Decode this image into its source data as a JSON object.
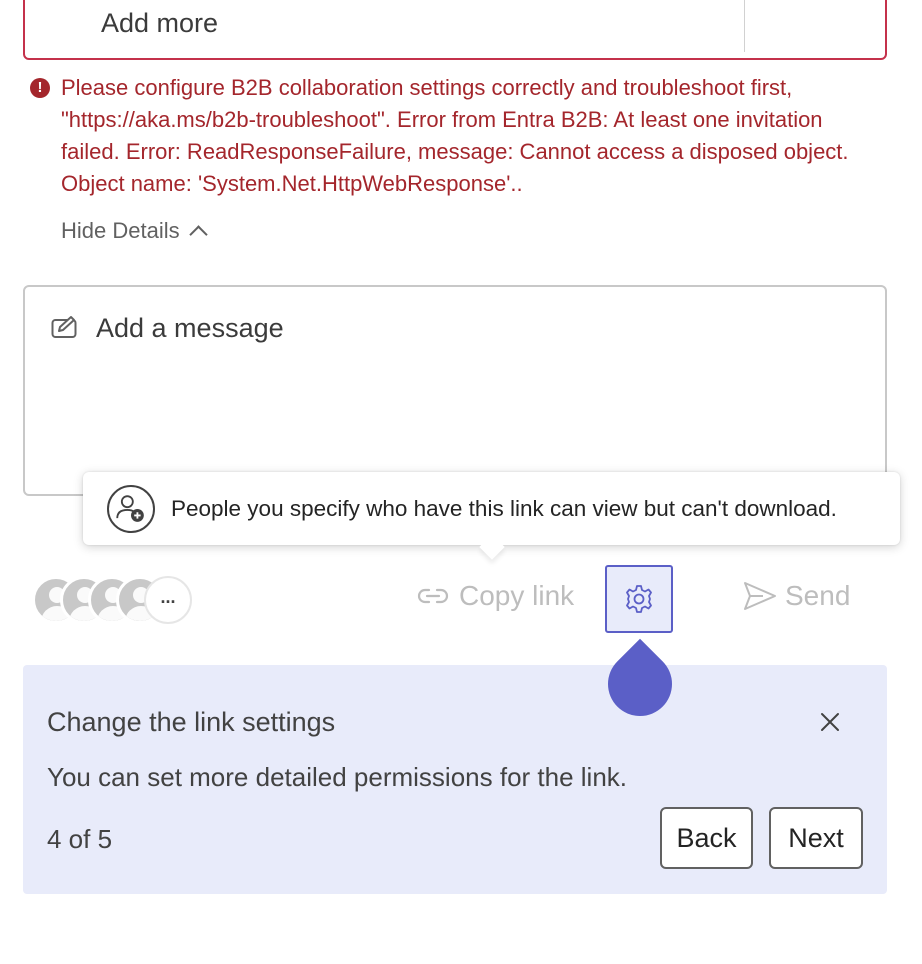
{
  "invite": {
    "add_more_label": "Add more"
  },
  "error": {
    "icon": "error-circle-icon",
    "message": "Please configure B2B collaboration settings correctly and troubleshoot first, \"https://aka.ms/b2b-troubleshoot\". Error from Entra B2B: At least one invitation failed. Error: ReadResponseFailure, message: Cannot access a disposed object. Object name: 'System.Net.HttpWebResponse'..",
    "hide_details_label": "Hide Details"
  },
  "message": {
    "placeholder": "Add a message"
  },
  "tooltip": {
    "text": "People you specify who have this link can view but can't download."
  },
  "actions": {
    "more_label": "...",
    "copy_link_label": "Copy link",
    "send_label": "Send"
  },
  "coachmark": {
    "title": "Change the link settings",
    "body": "You can set more detailed permissions for the link.",
    "counter": "4 of 5",
    "back_label": "Back",
    "next_label": "Next"
  },
  "colors": {
    "error": "#a4262c",
    "accent": "#5b5fc7",
    "coach_bg": "#e8ebfa"
  }
}
